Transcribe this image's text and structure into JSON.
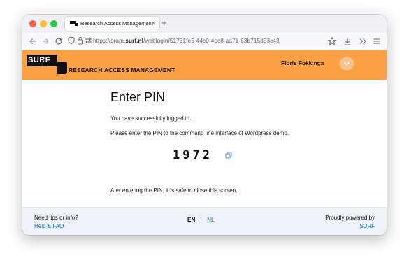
{
  "colors": {
    "header_bg": "#f9a042",
    "link": "#1a6fb0",
    "footer_bg": "#eef1f5"
  },
  "browser": {
    "tab_title": "Research Access Management",
    "tab_close": "×",
    "new_tab": "+",
    "url_prefix": "https://sram.",
    "url_domain": "surf.nl",
    "url_path": "/weblogin/51731fe5-44c0-4ec8-aa71-63b715d53c43",
    "icons": [
      "back-icon",
      "forward-icon",
      "reload-icon",
      "shield-icon",
      "lock-icon",
      "permissions-icon",
      "bookmark-star-icon",
      "download-icon",
      "overflow-chevron-icon",
      "menu-icon"
    ]
  },
  "header": {
    "logo_text": "SURF",
    "product_name": "RESEARCH ACCESS MANAGEMENT",
    "user_name": "Floris Fokkinga"
  },
  "main": {
    "title": "Enter PIN",
    "success_text": "You have successfully logged in.",
    "instruction_text": "Please enter the PIN to the command line interface of Wordpress demo.",
    "pin": "1972",
    "after_text": "Ater entering the PIN, it is safe to close this screen."
  },
  "footer": {
    "tips_text": "Need tips or info?",
    "help_link": "Help & FAQ",
    "lang_en": "EN",
    "lang_sep": "|",
    "lang_nl": "NL",
    "powered_text": "Proudly powered by",
    "powered_link": "SURF"
  }
}
